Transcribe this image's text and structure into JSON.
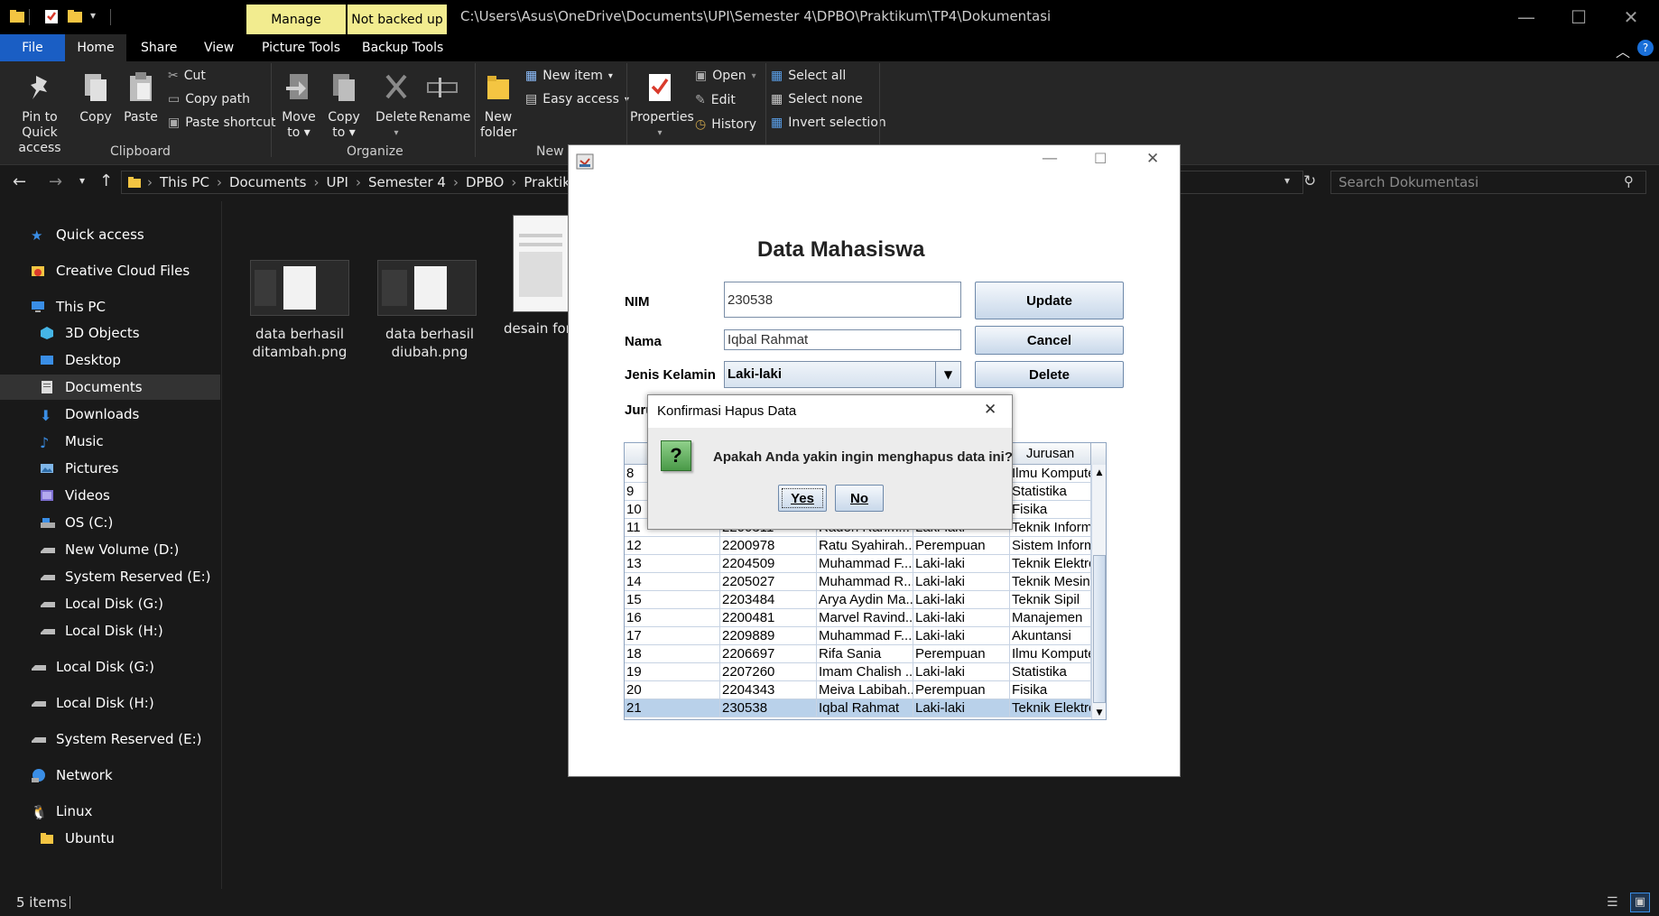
{
  "titlebar": {
    "tab_manage": "Manage",
    "tab_not_backed_up": "Not backed up",
    "path": "C:\\Users\\Asus\\OneDrive\\Documents\\UPI\\Semester 4\\DPBO\\Praktikum\\TP4\\Dokumentasi"
  },
  "ribbon_tabs": [
    "File",
    "Home",
    "Share",
    "View",
    "Picture Tools",
    "Backup Tools"
  ],
  "ribbon": {
    "clipboard": {
      "pin_line1": "Pin to Quick",
      "pin_line2": "access",
      "copy": "Copy",
      "paste": "Paste",
      "cut": "Cut",
      "copy_path": "Copy path",
      "paste_shortcut": "Paste shortcut",
      "label": "Clipboard"
    },
    "organize": {
      "move_to_line1": "Move",
      "move_to_line2": "to",
      "copy_to_line1": "Copy",
      "copy_to_line2": "to",
      "delete": "Delete",
      "rename": "Rename",
      "label": "Organize"
    },
    "new": {
      "new_folder_line1": "New",
      "new_folder_line2": "folder",
      "new_item": "New item",
      "easy_access": "Easy access",
      "label": "New"
    },
    "open": {
      "properties": "Properties",
      "open": "Open",
      "edit": "Edit",
      "history": "History"
    },
    "select": {
      "select_all": "Select all",
      "select_none": "Select none",
      "invert_selection": "Invert selection"
    }
  },
  "address": {
    "crumbs": [
      "This PC",
      "Documents",
      "UPI",
      "Semester 4",
      "DPBO",
      "Praktikum"
    ],
    "search_placeholder": "Search Dokumentasi"
  },
  "sidebar": {
    "items": [
      {
        "label": "Quick access",
        "icon": "star-icon"
      },
      {
        "label": "Creative Cloud Files",
        "icon": "creative-cloud-icon"
      },
      {
        "label": "This PC",
        "icon": "computer-icon"
      },
      {
        "label": "3D Objects",
        "icon": "cube-icon"
      },
      {
        "label": "Desktop",
        "icon": "desktop-icon"
      },
      {
        "label": "Documents",
        "icon": "documents-icon"
      },
      {
        "label": "Downloads",
        "icon": "download-icon"
      },
      {
        "label": "Music",
        "icon": "music-icon"
      },
      {
        "label": "Pictures",
        "icon": "pictures-icon"
      },
      {
        "label": "Videos",
        "icon": "videos-icon"
      },
      {
        "label": "OS (C:)",
        "icon": "drive-icon"
      },
      {
        "label": "New Volume (D:)",
        "icon": "drive-icon"
      },
      {
        "label": "System Reserved (E:)",
        "icon": "drive-icon"
      },
      {
        "label": "Local Disk (G:)",
        "icon": "drive-icon"
      },
      {
        "label": "Local Disk (H:)",
        "icon": "drive-icon"
      },
      {
        "label": "Local Disk (G:)",
        "icon": "drive-icon"
      },
      {
        "label": "Local Disk (H:)",
        "icon": "drive-icon"
      },
      {
        "label": "System Reserved (E:)",
        "icon": "drive-icon"
      },
      {
        "label": "Network",
        "icon": "network-icon"
      },
      {
        "label": "Linux",
        "icon": "linux-icon"
      },
      {
        "label": "Ubuntu",
        "icon": "folder-icon"
      }
    ]
  },
  "files": [
    {
      "line1": "data berhasil",
      "line2": "ditambah.png"
    },
    {
      "line1": "data berhasil",
      "line2": "diubah.png"
    },
    {
      "line1": "desain for",
      "line2": ""
    }
  ],
  "status": {
    "items_count": "5 items"
  },
  "form": {
    "title": "Data Mahasiswa",
    "nim_label": "NIM",
    "nim_value": "230538",
    "nama_label": "Nama",
    "nama_value": "Iqbal Rahmat",
    "jk_label": "Jenis Kelamin",
    "jk_value": "Laki-laki",
    "jurusan_label_partial": "Juru",
    "update": "Update",
    "cancel": "Cancel",
    "delete": "Delete"
  },
  "table": {
    "header_last": "Jurusan",
    "rows": [
      [
        "8",
        "",
        "",
        "",
        "Ilmu Komputer"
      ],
      [
        "9",
        "",
        "",
        "",
        "Statistika"
      ],
      [
        "10",
        "",
        "",
        "",
        "Fisika"
      ],
      [
        "11",
        "2200311",
        "Raden Rahm...",
        "Laki-laki",
        "Teknik Inform..."
      ],
      [
        "12",
        "2200978",
        "Ratu Syahirah...",
        "Perempuan",
        "Sistem Inform..."
      ],
      [
        "13",
        "2204509",
        "Muhammad F...",
        "Laki-laki",
        "Teknik Elektro"
      ],
      [
        "14",
        "2205027",
        "Muhammad R...",
        "Laki-laki",
        "Teknik Mesin"
      ],
      [
        "15",
        "2203484",
        "Arya Aydin Ma...",
        "Laki-laki",
        "Teknik Sipil"
      ],
      [
        "16",
        "2200481",
        "Marvel Ravind...",
        "Laki-laki",
        "Manajemen"
      ],
      [
        "17",
        "2209889",
        "Muhammad F...",
        "Laki-laki",
        "Akuntansi"
      ],
      [
        "18",
        "2206697",
        "Rifa Sania",
        "Perempuan",
        "Ilmu Komputer"
      ],
      [
        "19",
        "2207260",
        "Imam Chalish ...",
        "Laki-laki",
        "Statistika"
      ],
      [
        "20",
        "2204343",
        "Meiva Labibah...",
        "Perempuan",
        "Fisika"
      ],
      [
        "21",
        "230538",
        "Iqbal Rahmat",
        "Laki-laki",
        "Teknik Elektro"
      ]
    ],
    "selected_row": 13
  },
  "confirm": {
    "title": "Konfirmasi Hapus Data",
    "message": "Apakah Anda yakin ingin menghapus data ini?",
    "yes": "Yes",
    "no": "No"
  },
  "colors": {
    "accent": "#1a5ec4",
    "context_tab": "#f2ec8f",
    "selection": "#b9d1ea"
  }
}
